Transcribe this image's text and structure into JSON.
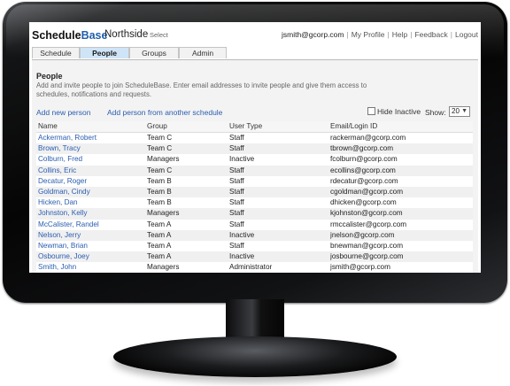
{
  "app": {
    "logo_schedule": "Schedule",
    "logo_base": "Base",
    "organization": "Northside",
    "select_link": "Select"
  },
  "user_links": {
    "email": "jsmith@gcorp.com",
    "profile": "My Profile",
    "help": "Help",
    "feedback": "Feedback",
    "logout": "Logout"
  },
  "tabs": [
    {
      "label": "Schedule",
      "active": false
    },
    {
      "label": "People",
      "active": true
    },
    {
      "label": "Groups",
      "active": false
    },
    {
      "label": "Admin",
      "active": false
    }
  ],
  "page": {
    "title": "People",
    "description": "Add and invite people to join ScheduleBase. Enter email addresses to invite people and give them access to schedules, notifications and requests."
  },
  "actions": {
    "add_new": "Add new person",
    "add_from_schedule": "Add person from another schedule",
    "hide_inactive": "Hide Inactive",
    "show_label": "Show:",
    "show_value": "20"
  },
  "table": {
    "columns": [
      "Name",
      "Group",
      "User Type",
      "Email/Login ID"
    ],
    "rows": [
      [
        "Ackerman, Robert",
        "Team C",
        "Staff",
        "rackerman@gcorp.com"
      ],
      [
        "Brown, Tracy",
        "Team C",
        "Staff",
        "tbrown@gcorp.com"
      ],
      [
        "Colburn, Fred",
        "Managers",
        "Inactive",
        "fcolburn@gcorp.com"
      ],
      [
        "Collins, Eric",
        "Team C",
        "Staff",
        "ecollins@gcorp.com"
      ],
      [
        "Decatur, Roger",
        "Team B",
        "Staff",
        "rdecatur@gcorp.com"
      ],
      [
        "Goldman, Cindy",
        "Team B",
        "Staff",
        "cgoldman@gcorp.com"
      ],
      [
        "Hicken, Dan",
        "Team B",
        "Staff",
        "dhicken@gcorp.com"
      ],
      [
        "Johnston, Kelly",
        "Managers",
        "Staff",
        "kjohnston@gcorp.com"
      ],
      [
        "McCalister, Randel",
        "Team A",
        "Staff",
        "rmccalister@gcorp.com"
      ],
      [
        "Nelson, Jerry",
        "Team A",
        "Inactive",
        "jnelson@gcorp.com"
      ],
      [
        "Newman, Brian",
        "Team A",
        "Staff",
        "bnewman@gcorp.com"
      ],
      [
        "Osbourne, Joey",
        "Team A",
        "Inactive",
        "josbourne@gcorp.com"
      ],
      [
        "Smith, John",
        "Managers",
        "Administrator",
        "jsmith@gcorp.com"
      ]
    ]
  },
  "colors": {
    "link": "#2a5db0",
    "active_tab": "#cfe4f7",
    "logo_accent": "#1f5fae"
  }
}
